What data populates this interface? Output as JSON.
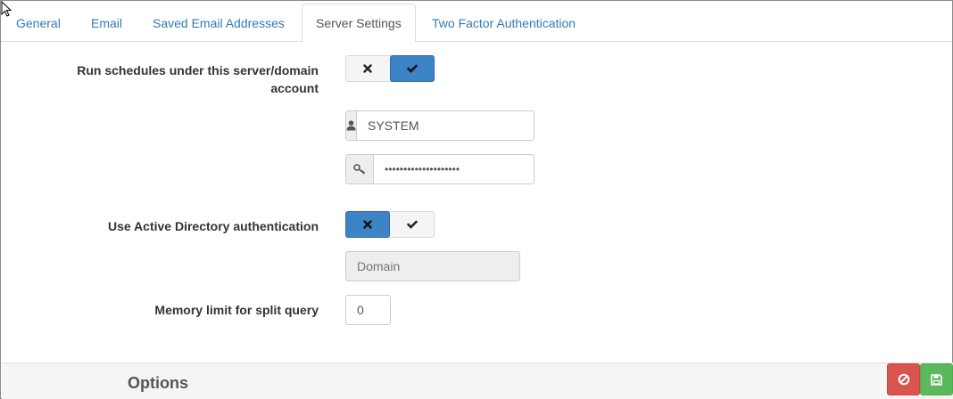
{
  "tabs": [
    {
      "label": "General"
    },
    {
      "label": "Email"
    },
    {
      "label": "Saved Email Addresses"
    },
    {
      "label": "Server Settings",
      "active": true
    },
    {
      "label": "Two Factor Authentication"
    }
  ],
  "form": {
    "run_schedules": {
      "label_line1": "Run schedules under this server/domain",
      "label_line2": "account",
      "state": "yes",
      "off_icon": "times-icon",
      "on_icon": "check-icon"
    },
    "username": {
      "value": "SYSTEM",
      "icon": "user-icon"
    },
    "password": {
      "value": "••••••••••••••••••••",
      "icon": "key-icon"
    },
    "active_directory": {
      "label": "Use Active Directory authentication",
      "state": "no",
      "off_icon": "times-icon",
      "on_icon": "check-icon"
    },
    "domain": {
      "placeholder": "Domain",
      "value": ""
    },
    "memory_limit": {
      "label": "Memory limit for split query",
      "value": "0"
    }
  },
  "footer": {
    "title": "Options",
    "cancel_icon": "ban-icon",
    "save_icon": "floppy-icon",
    "cancel_color": "#d9534f",
    "save_color": "#5cb85c"
  },
  "colors": {
    "accent": "#3c84c6",
    "link": "#337ab7"
  }
}
